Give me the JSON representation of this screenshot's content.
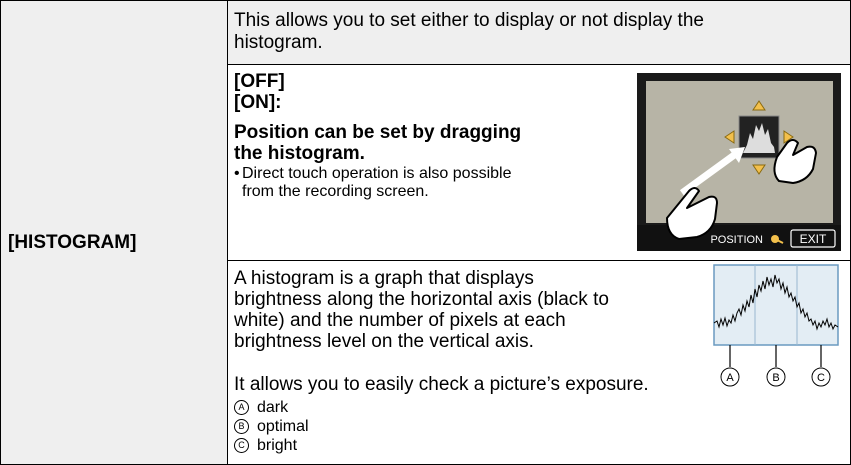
{
  "row_label": "[HISTOGRAM]",
  "description": "This allows you to set either to display or not display the histogram.",
  "options": {
    "off": "[OFF]",
    "on": "[ON]:"
  },
  "on_heading": "Position can be set by dragging the histogram.",
  "on_note_bullet": "•",
  "on_note": "Direct touch operation is also possible from the recording screen.",
  "screen": {
    "position_label": "POSITION",
    "exit_label": "EXIT"
  },
  "histogram_text": "A histogram is a graph that displays brightness along the horizontal axis (black to white) and the number of pixels at each brightness level on the vertical axis.",
  "histogram_text2": "It allows you to easily check a picture’s exposure.",
  "legend": [
    {
      "mark": "A",
      "label": "dark"
    },
    {
      "mark": "B",
      "label": "optimal"
    },
    {
      "mark": "C",
      "label": "bright"
    }
  ],
  "graph_markers": [
    "A",
    "B",
    "C"
  ]
}
